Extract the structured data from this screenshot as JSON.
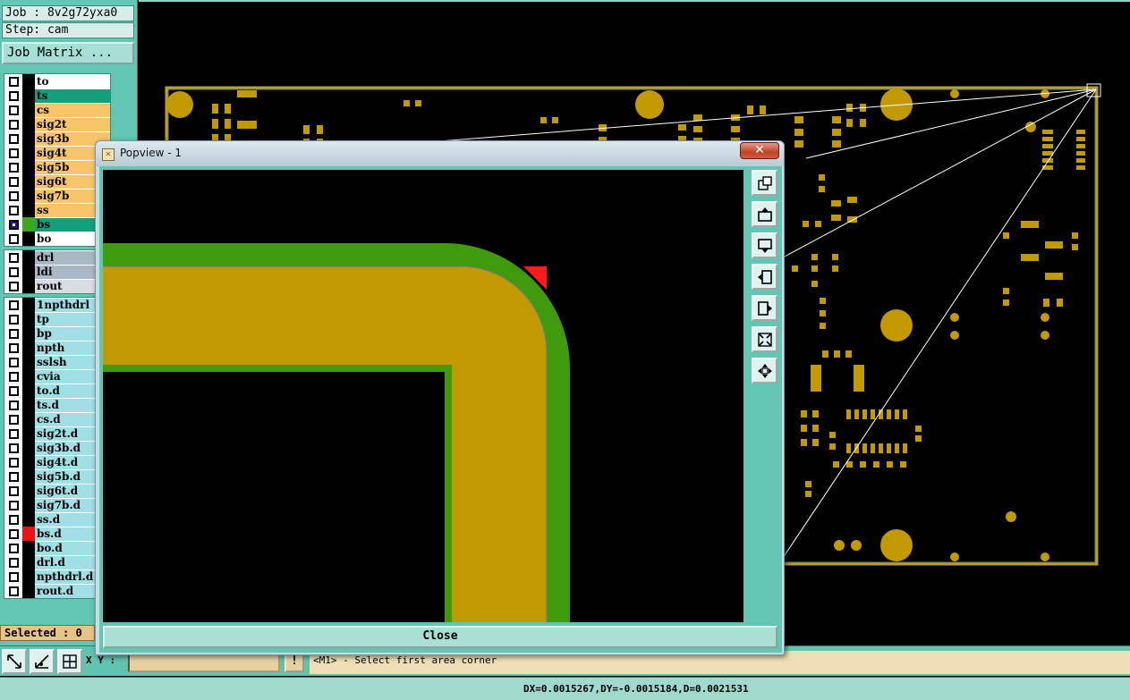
{
  "job": {
    "label": "Job : 8v2g72yxa0"
  },
  "step": {
    "label": "Step: cam"
  },
  "job_matrix": {
    "label": "Job Matrix ..."
  },
  "layers": {
    "board": [
      {
        "name": "to",
        "color": "#ffffff",
        "marker": "",
        "checked": false
      },
      {
        "name": "ts",
        "color": "#12a07a",
        "marker": "",
        "checked": false
      },
      {
        "name": "cs",
        "color": "#f7c46a",
        "marker": "",
        "checked": false
      },
      {
        "name": "sig2t",
        "color": "#f7c46a",
        "marker": "",
        "checked": false
      },
      {
        "name": "sig3b",
        "color": "#f7c46a",
        "marker": "",
        "checked": false
      },
      {
        "name": "sig4t",
        "color": "#f7c46a",
        "marker": "",
        "checked": false
      },
      {
        "name": "sig5b",
        "color": "#f7c46a",
        "marker": "",
        "checked": false
      },
      {
        "name": "sig6t",
        "color": "#f7c46a",
        "marker": "",
        "checked": false
      },
      {
        "name": "sig7b",
        "color": "#f7c46a",
        "marker": "",
        "checked": false
      },
      {
        "name": "ss",
        "color": "#f7c46a",
        "marker": "",
        "checked": false
      },
      {
        "name": "bs",
        "color": "#12a07a",
        "marker": "#3aa81c",
        "checked": true
      },
      {
        "name": "bo",
        "color": "#ffffff",
        "marker": "",
        "checked": false
      }
    ],
    "drill": [
      {
        "name": "drl",
        "color": "#a9b8c6",
        "marker": "",
        "checked": false
      },
      {
        "name": "ldi",
        "color": "#a9b8c6",
        "marker": "",
        "checked": false
      },
      {
        "name": "rout",
        "color": "#d8dde2",
        "marker": "",
        "checked": false
      }
    ],
    "misc": [
      {
        "name": "1npthdrl",
        "color": "#9fdfe5",
        "marker": "",
        "checked": false
      },
      {
        "name": "tp",
        "color": "#9fdfe5",
        "marker": "",
        "checked": false
      },
      {
        "name": "bp",
        "color": "#9fdfe5",
        "marker": "",
        "checked": false
      },
      {
        "name": "npth",
        "color": "#9fdfe5",
        "marker": "",
        "checked": false
      },
      {
        "name": "sslsh",
        "color": "#9fdfe5",
        "marker": "",
        "checked": false
      },
      {
        "name": "cvia",
        "color": "#9fdfe5",
        "marker": "",
        "checked": false
      },
      {
        "name": "to.d",
        "color": "#9fdfe5",
        "marker": "",
        "checked": false
      },
      {
        "name": "ts.d",
        "color": "#9fdfe5",
        "marker": "",
        "checked": false
      },
      {
        "name": "cs.d",
        "color": "#9fdfe5",
        "marker": "",
        "checked": false
      },
      {
        "name": "sig2t.d",
        "color": "#9fdfe5",
        "marker": "",
        "checked": false
      },
      {
        "name": "sig3b.d",
        "color": "#9fdfe5",
        "marker": "",
        "checked": false
      },
      {
        "name": "sig4t.d",
        "color": "#9fdfe5",
        "marker": "",
        "checked": false
      },
      {
        "name": "sig5b.d",
        "color": "#9fdfe5",
        "marker": "",
        "checked": false
      },
      {
        "name": "sig6t.d",
        "color": "#9fdfe5",
        "marker": "",
        "checked": false
      },
      {
        "name": "sig7b.d",
        "color": "#9fdfe5",
        "marker": "",
        "checked": false
      },
      {
        "name": "ss.d",
        "color": "#9fdfe5",
        "marker": "",
        "checked": false
      },
      {
        "name": "bs.d",
        "color": "#9fdfe5",
        "marker": "#ee1111",
        "checked": false
      },
      {
        "name": "bo.d",
        "color": "#9fdfe5",
        "marker": "",
        "checked": false
      },
      {
        "name": "drl.d",
        "color": "#9fdfe5",
        "marker": "",
        "checked": false
      },
      {
        "name": "npthdrl.d",
        "color": "#9fdfe5",
        "marker": "",
        "checked": false
      },
      {
        "name": "rout.d",
        "color": "#9fdfe5",
        "marker": "",
        "checked": false
      }
    ]
  },
  "selected": {
    "label": "Selected : 0"
  },
  "toolbar": {
    "xy_label": "X Y :",
    "xy_value": "",
    "prompt_button": "!",
    "prompt_text": "<M1> - Select first area corner",
    "icons": [
      "zoom-area-icon",
      "measure-icon",
      "snap-grid-icon"
    ]
  },
  "status": {
    "text": "DX=0.0015267,DY=-0.0015184,D=0.0021531"
  },
  "popview": {
    "title": "Popview - 1",
    "close_x": "✕",
    "close_button": "Close",
    "tools": [
      "window-restore-icon",
      "pan-up-icon",
      "pan-down-icon",
      "pan-left-icon",
      "pan-right-icon",
      "zoom-fit-icon",
      "zoom-center-icon"
    ]
  },
  "colors": {
    "copper": "#c29a00",
    "mask": "#3f9a0c",
    "accent": "#62c6b2",
    "highlight": "#ff1a1a"
  }
}
